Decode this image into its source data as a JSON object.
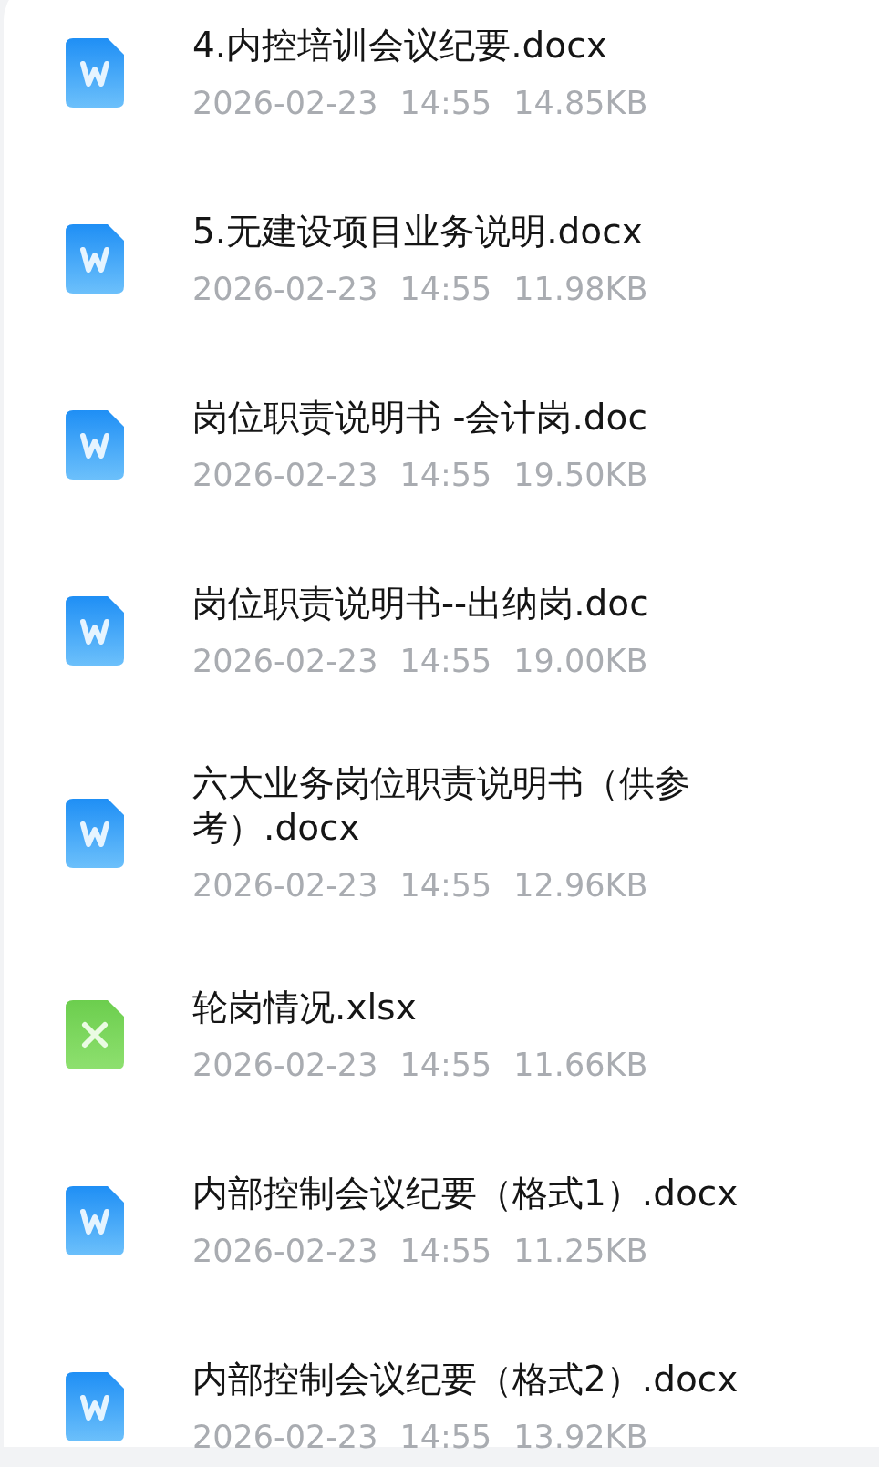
{
  "files": [
    {
      "kind": "word",
      "name": "4.内控培训会议纪要.docx",
      "date": "2026-02-23",
      "time": "14:55",
      "size": "14.85KB"
    },
    {
      "kind": "word",
      "name": "5.无建设项目业务说明.docx",
      "date": "2026-02-23",
      "time": "14:55",
      "size": "11.98KB"
    },
    {
      "kind": "word",
      "name": "岗位职责说明书 -会计岗.doc",
      "date": "2026-02-23",
      "time": "14:55",
      "size": "19.50KB"
    },
    {
      "kind": "word",
      "name": "岗位职责说明书--出纳岗.doc",
      "date": "2026-02-23",
      "time": "14:55",
      "size": "19.00KB"
    },
    {
      "kind": "word",
      "name": "六大业务岗位职责说明书（供参考）.docx",
      "date": "2026-02-23",
      "time": "14:55",
      "size": "12.96KB"
    },
    {
      "kind": "excel",
      "name": "轮岗情况.xlsx",
      "date": "2026-02-23",
      "time": "14:55",
      "size": "11.66KB"
    },
    {
      "kind": "word",
      "name": "内部控制会议纪要（格式1）.docx",
      "date": "2026-02-23",
      "time": "14:55",
      "size": "11.25KB"
    },
    {
      "kind": "word",
      "name": "内部控制会议纪要（格式2）.docx",
      "date": "2026-02-23",
      "time": "14:55",
      "size": "13.92KB"
    }
  ]
}
